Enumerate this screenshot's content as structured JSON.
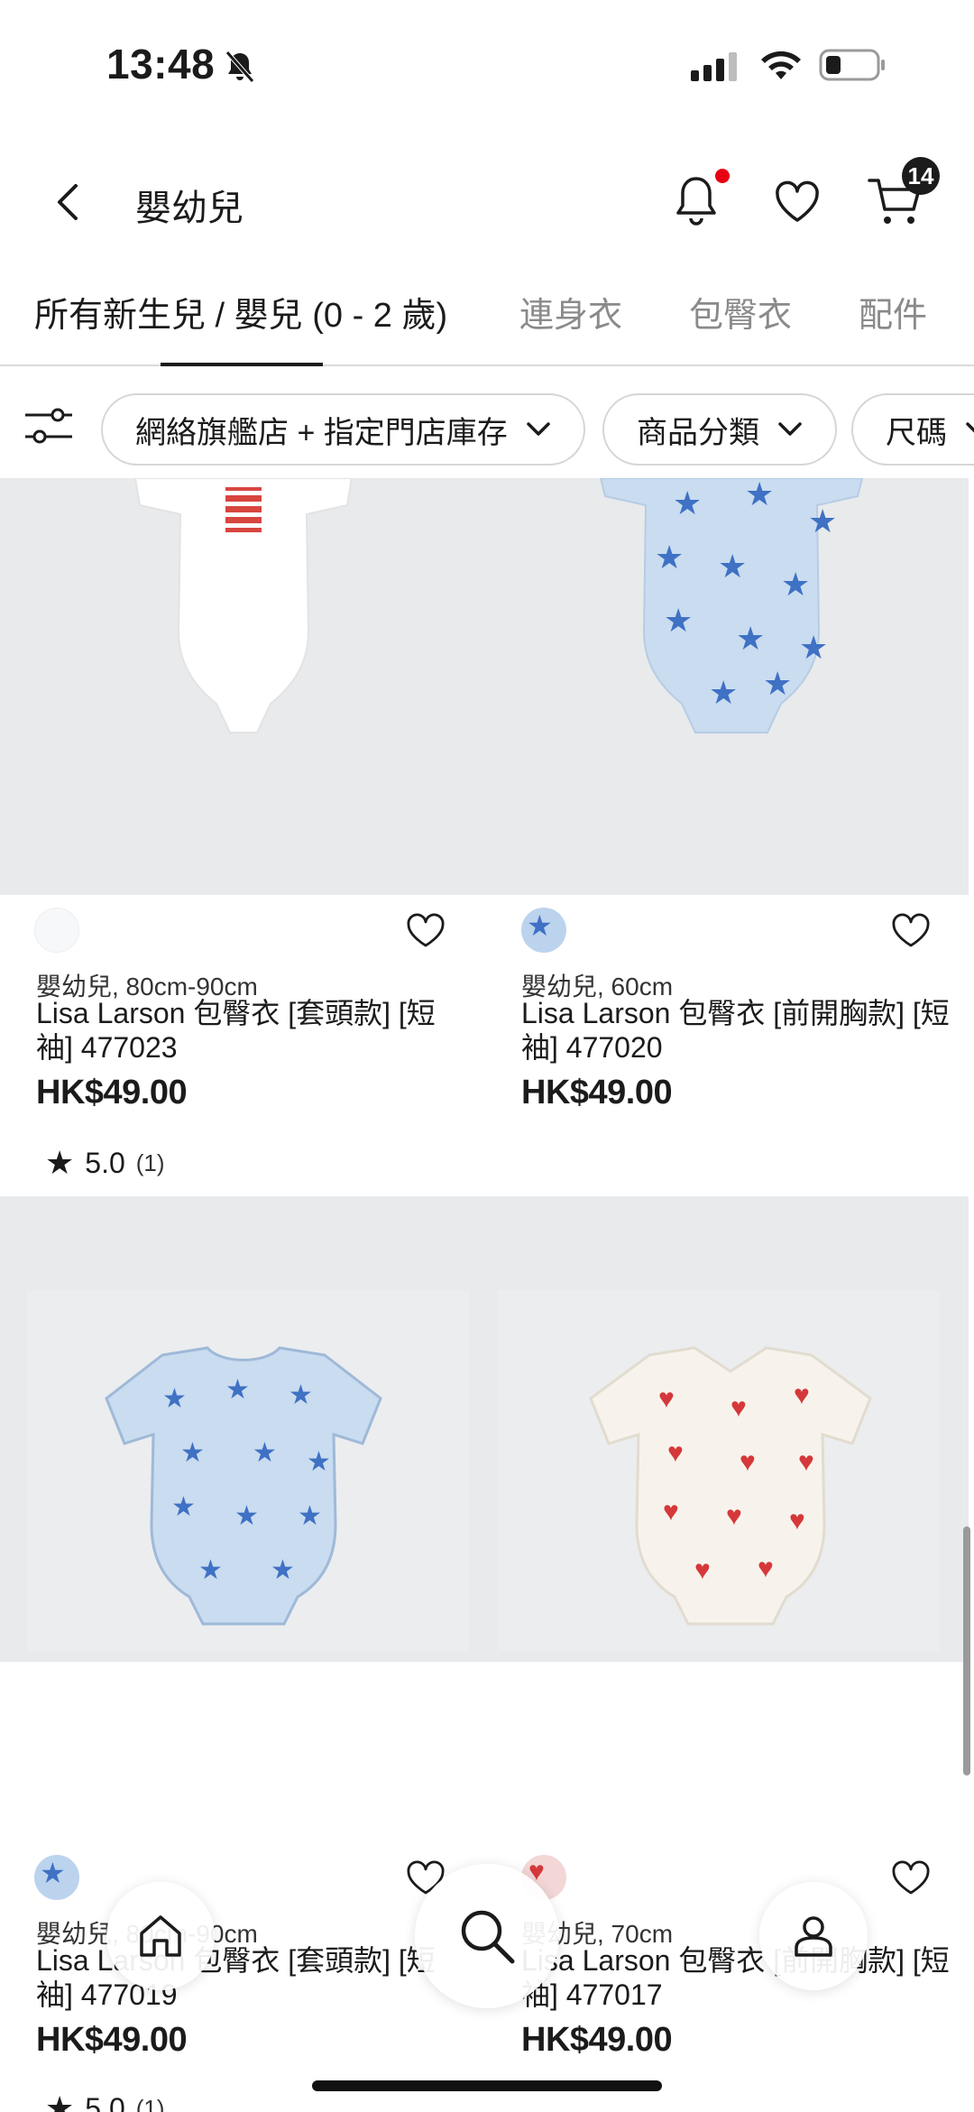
{
  "status_bar": {
    "time": "13:48"
  },
  "header": {
    "title": "嬰幼兒",
    "cart_count": "14"
  },
  "tabs": [
    {
      "label": "所有新生兒 / 嬰兒 (0 - 2 歲)"
    },
    {
      "label": "連身衣"
    },
    {
      "label": "包臀衣"
    },
    {
      "label": "配件"
    }
  ],
  "filters": [
    {
      "label": "網絡旗艦店 + 指定門店庫存"
    },
    {
      "label": "商品分類"
    },
    {
      "label": "尺碼"
    }
  ],
  "products": [
    {
      "size": "嬰幼兒, 80cm-90cm",
      "name": "Lisa Larson 包臀衣 [套頭款] [短袖] 477023",
      "price": "HK$49.00",
      "rating": "5.0",
      "reviews": "(1)",
      "swatch_color": "#f7f8fa"
    },
    {
      "size": "嬰幼兒, 60cm",
      "name": "Lisa Larson 包臀衣 [前開胸款] [短袖] 477020",
      "price": "HK$49.00",
      "rating": "",
      "reviews": "",
      "swatch_color": "#bcd3ee"
    },
    {
      "size": "嬰幼兒, 80cm-90cm",
      "name": "Lisa Larson 包臀衣 [套頭款] [短袖] 477019",
      "price": "HK$49.00",
      "rating": "5.0",
      "reviews": "(1)",
      "swatch_color": "#bcd3ee"
    },
    {
      "size": "嬰幼兒, 70cm",
      "name": "Lisa Larson 包臀衣 [前開胸款] [短袖] 477017",
      "price": "HK$49.00",
      "rating": "",
      "reviews": "",
      "swatch_color": "#f3d6d6"
    }
  ],
  "colors": {
    "accent_red": "#e60012",
    "image_bg": "#e8eaec",
    "text": "#1b1b1b"
  },
  "icons": [
    "bell-off-icon",
    "signal-icon",
    "wifi-icon",
    "battery-icon",
    "back-icon",
    "bell-icon",
    "heart-icon",
    "cart-icon",
    "filter-icon",
    "chevron-down-icon",
    "star-icon",
    "home-icon",
    "search-icon",
    "user-icon"
  ]
}
